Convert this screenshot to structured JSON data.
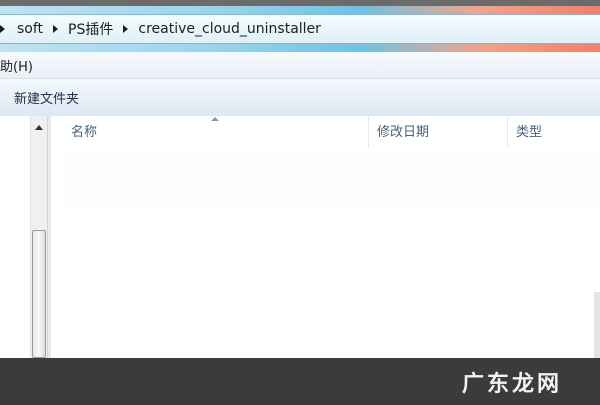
{
  "address_bar": {
    "crumbs": [
      "soft",
      "PS插件",
      "creative_cloud_uninstaller"
    ]
  },
  "menu": {
    "help_label": "助(H)"
  },
  "toolbar": {
    "new_folder_label": "新建文件夹"
  },
  "file_list": {
    "columns": {
      "name": "名称",
      "date_modified": "修改日期",
      "type": "类型"
    },
    "rows": []
  },
  "watermark": {
    "text": "广东龙网"
  },
  "colors": {
    "footer_bg": "#3b3b3b",
    "toolbar_text": "#1e2f45",
    "header_text": "#4c607a"
  }
}
